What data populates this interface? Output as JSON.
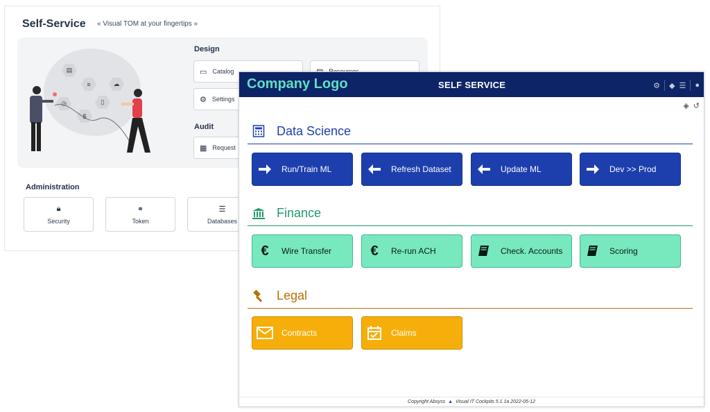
{
  "back": {
    "title": "Self-Service",
    "subtitle": "« Visual TOM at your fingertips »",
    "design_heading": "Design",
    "audit_heading": "Audit",
    "design_buttons": [
      "Catalog",
      "Resources",
      "Settings"
    ],
    "audit_buttons": [
      "Request"
    ],
    "admin_heading": "Administration",
    "admin_cards": [
      "Security",
      "Token",
      "Databases"
    ]
  },
  "front": {
    "logo": "Company Logo",
    "title": "SELF SERVICE",
    "categories": [
      {
        "title": "Data Science",
        "color": "#1d3fae",
        "icon": "calculator-icon",
        "tiles": [
          {
            "label": "Run/Train ML",
            "icon": "arrow-right-icon"
          },
          {
            "label": "Refresh Dataset",
            "icon": "arrow-left-icon"
          },
          {
            "label": "Update ML",
            "icon": "arrow-left-icon"
          },
          {
            "label": "Dev >> Prod",
            "icon": "arrow-right-icon"
          }
        ]
      },
      {
        "title": "Finance",
        "color": "#1e9a6a",
        "icon": "bank-icon",
        "tiles": [
          {
            "label": "Wire Transfer",
            "icon": "euro-icon"
          },
          {
            "label": "Re-run ACH",
            "icon": "euro-icon"
          },
          {
            "label": "Check. Accounts",
            "icon": "book-icon"
          },
          {
            "label": "Scoring",
            "icon": "book-icon"
          }
        ]
      },
      {
        "title": "Legal",
        "color": "#b5700a",
        "icon": "gavel-icon",
        "tiles": [
          {
            "label": "Contracts",
            "icon": "envelope-icon"
          },
          {
            "label": "Claims",
            "icon": "calendar-check-icon"
          }
        ]
      }
    ],
    "footer_copyright": "Copyright Absyss",
    "footer_version": "Visual IT Cockpits 5.1.1a 2022-05-12"
  }
}
